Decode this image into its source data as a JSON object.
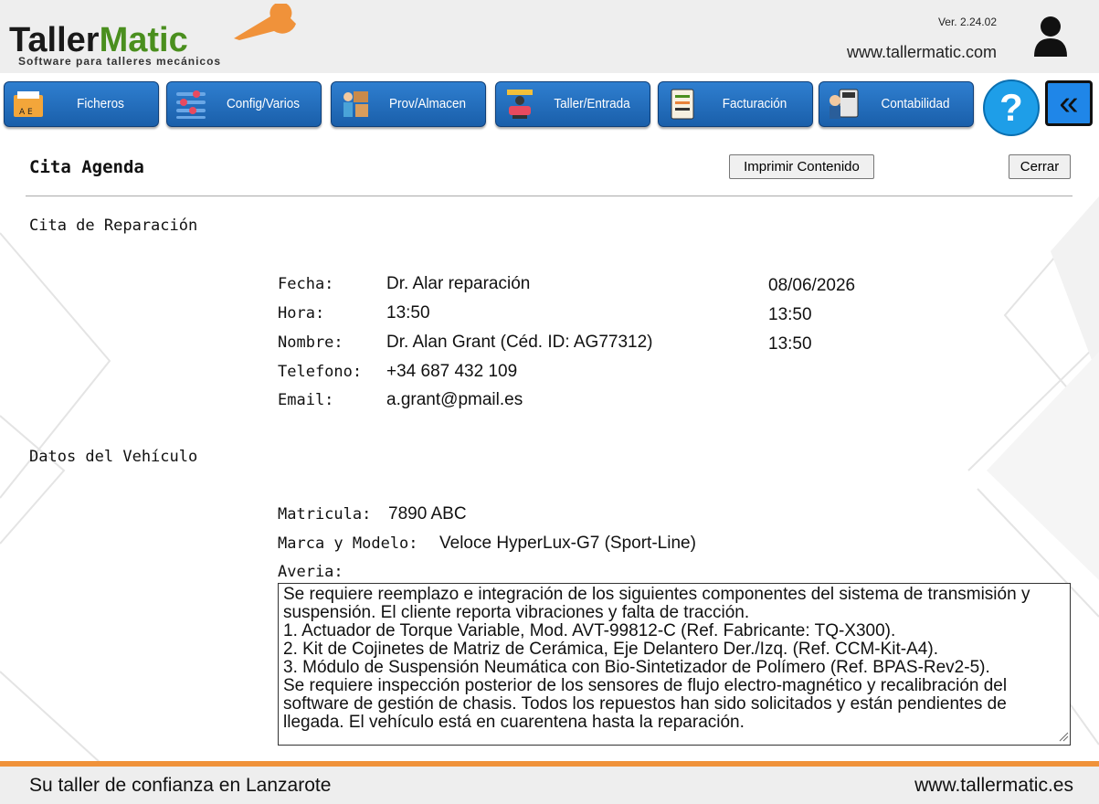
{
  "header": {
    "logo_part1": "Taller",
    "logo_part2": "Matic",
    "logo_subtitle": "Software para talleres mecánicos",
    "version": "Ver. 2.24.02",
    "website": "www.tallermatic.com"
  },
  "nav": {
    "items": [
      {
        "label": "Ficheros",
        "icon": "folder-icon"
      },
      {
        "label": "Config/Varios",
        "icon": "sliders-icon"
      },
      {
        "label": "Prov/Almacen",
        "icon": "warehouse-icon"
      },
      {
        "label": "Taller/Entrada",
        "icon": "car-lift-icon"
      },
      {
        "label": "Facturación",
        "icon": "invoice-icon"
      },
      {
        "label": "Contabilidad",
        "icon": "calculator-icon"
      }
    ],
    "help_label": "?",
    "back_label": "«"
  },
  "page": {
    "title": "Cita Agenda",
    "print_label": "Imprimir Contenido",
    "close_label": "Cerrar"
  },
  "cita": {
    "section_title": "Cita de Reparación",
    "fecha_label": "Fecha:",
    "fecha_value": "Dr. Alar reparación",
    "fecha_extra": "08/06/2026",
    "hora_label": "Hora:",
    "hora_value": "13:50",
    "hora_extra": "13:50",
    "nombre_label": "Nombre:",
    "nombre_value": "Dr. Alan Grant (Céd. ID: AG77312)",
    "nombre_extra": "13:50",
    "telefono_label": "Telefono:",
    "telefono_value": "+34 687 432 109",
    "email_label": "Email:",
    "email_value": "a.grant@pmail.es"
  },
  "vehiculo": {
    "section_title": "Datos del Vehículo",
    "matricula_label": "Matricula:",
    "matricula_value": "7890 ABC",
    "marca_label": "Marca y Modelo:",
    "marca_value": "Veloce HyperLux-G7 (Sport-Line)",
    "averia_label": "Averia:",
    "averia_value": "Se requiere reemplazo e integración de los siguientes componentes del sistema de transmisión y suspensión. El cliente reporta vibraciones y falta de tracción.\n1. Actuador de Torque Variable, Mod. AVT-99812-C (Ref. Fabricante: TQ-X300).\n2. Kit de Cojinetes de Matriz de Cerámica, Eje Delantero Der./Izq. (Ref. CCM-Kit-A4).\n3. Módulo de Suspensión Neumática con Bio-Sintetizador de Polímero (Ref. BPAS-Rev2-5).\nSe requiere inspección posterior de los sensores de flujo electro-magnético y recalibración del software de gestión de chasis. Todos los repuestos han sido solicitados y están pendientes de llegada. El vehículo está en cuarentena hasta la reparación."
  },
  "footer": {
    "tagline": "Su taller de confianza en Lanzarote",
    "website": "www.tallermatic.es"
  },
  "colors": {
    "nav_blue": "#1a5faa",
    "logo_green": "#4a8f1e",
    "logo_orange": "#f0923a",
    "footer_accent": "#f0923a",
    "help_blue": "#1e9ee8"
  }
}
